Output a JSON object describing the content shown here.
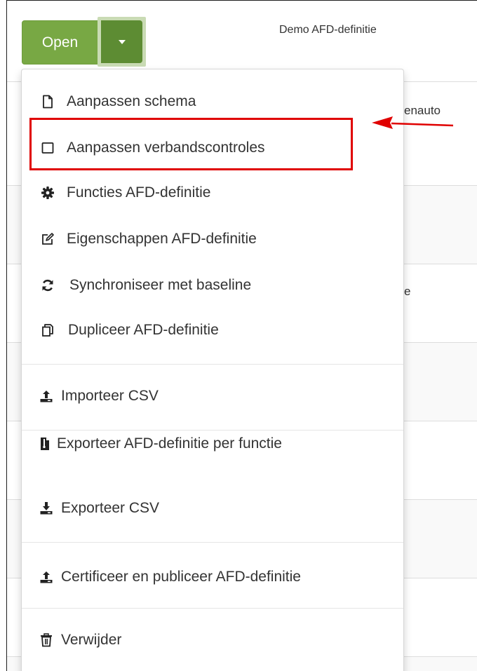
{
  "header": {
    "title": "Demo AFD-definitie"
  },
  "open_button": {
    "label": "Open"
  },
  "background": {
    "fragment_1": "enauto",
    "fragment_2": "e"
  },
  "menu": {
    "items": [
      {
        "label": "Aanpassen schema",
        "icon": "file-outline-icon"
      },
      {
        "label": "Aanpassen verbandscontroles",
        "icon": "square-outline-icon"
      },
      {
        "label": "Functies AFD-definitie",
        "icon": "gear-icon"
      },
      {
        "label": "Eigenschappen AFD-definitie",
        "icon": "edit-icon"
      },
      {
        "label": "Synchroniseer met baseline",
        "icon": "refresh-icon"
      },
      {
        "label": "Dupliceer AFD-definitie",
        "icon": "copy-icon"
      },
      {
        "label": "Importeer CSV",
        "icon": "upload-icon"
      },
      {
        "label": "Exporteer AFD-definitie per functie",
        "icon": "file-export-icon"
      },
      {
        "label": "Exporteer CSV",
        "icon": "download-icon"
      },
      {
        "label": "Certificeer en publiceer AFD-definitie",
        "icon": "upload-icon"
      },
      {
        "label": "Verwijder",
        "icon": "trash-icon"
      }
    ]
  },
  "annotation": {
    "highlight_color": "#e00000"
  },
  "colors": {
    "primary_button": "#78a844",
    "caret_button": "#5d8c33"
  }
}
